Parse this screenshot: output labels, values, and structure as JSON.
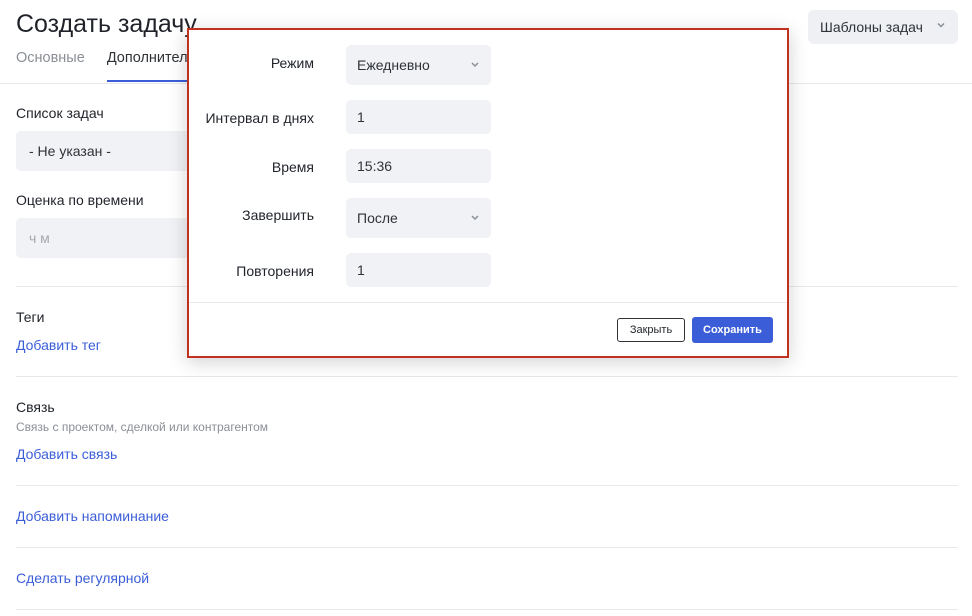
{
  "header": {
    "title": "Создать задачу",
    "templates_label": "Шаблоны задач"
  },
  "tabs": [
    {
      "label": "Основные",
      "active": false
    },
    {
      "label": "Дополнительно",
      "active": true
    }
  ],
  "form": {
    "task_list_label": "Список задач",
    "task_list_value": "- Не указан -",
    "time_estimate_label": "Оценка по времени",
    "time_estimate_placeholder": "ч м",
    "tags_label": "Теги",
    "add_tag": "Добавить тег",
    "link_label": "Связь",
    "link_hint": "Связь с проектом, сделкой или контрагентом",
    "add_link": "Добавить связь",
    "add_reminder": "Добавить напоминание",
    "make_recurring": "Сделать регулярной"
  },
  "modal": {
    "mode_label": "Режим",
    "mode_value": "Ежедневно",
    "interval_label": "Интервал в днях",
    "interval_value": "1",
    "time_label": "Время",
    "time_value": "15:36",
    "finish_label": "Завершить",
    "finish_value": "После",
    "repeats_label": "Повторения",
    "repeats_value": "1",
    "close_label": "Закрыть",
    "save_label": "Сохранить"
  },
  "colors": {
    "accent": "#3b5ed8",
    "highlight_border": "#c0311f",
    "field_bg": "#f1f2f5"
  }
}
